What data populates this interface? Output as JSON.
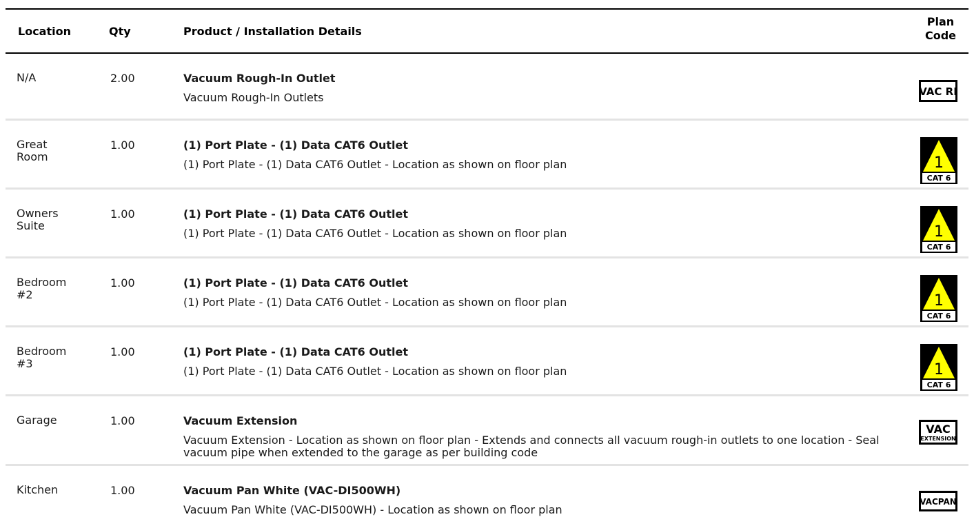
{
  "header": {
    "location": "Location",
    "qty": "Qty",
    "product": "Product / Installation Details",
    "plan_code_line1": "Plan",
    "plan_code_line2": "Code"
  },
  "rows": [
    {
      "location": "N/A",
      "qty": "2.00",
      "title": "Vacuum Rough-In Outlet",
      "description": "Vacuum Rough-In Outlets",
      "plan_code": "VAC RI",
      "icon": "vac-ri-icon"
    },
    {
      "location": "Great Room",
      "qty": "1.00",
      "title": "(1) Port Plate - (1) Data CAT6 Outlet",
      "description": "(1) Port Plate - (1) Data CAT6 Outlet - Location as shown on floor plan",
      "plan_code": "CAT 6",
      "plan_num": "1",
      "icon": "cat6-triangle-icon"
    },
    {
      "location": "Owners Suite",
      "qty": "1.00",
      "title": "(1) Port Plate - (1) Data CAT6 Outlet",
      "description": "(1) Port Plate - (1) Data CAT6 Outlet - Location as shown on floor plan",
      "plan_code": "CAT 6",
      "plan_num": "1",
      "icon": "cat6-triangle-icon"
    },
    {
      "location": "Bedroom #2",
      "qty": "1.00",
      "title": "(1) Port Plate - (1) Data CAT6 Outlet",
      "description": "(1) Port Plate - (1) Data CAT6 Outlet - Location as shown on floor plan",
      "plan_code": "CAT 6",
      "plan_num": "1",
      "icon": "cat6-triangle-icon"
    },
    {
      "location": "Bedroom #3",
      "qty": "1.00",
      "title": "(1) Port Plate - (1) Data CAT6 Outlet",
      "description": "(1) Port Plate - (1) Data CAT6 Outlet - Location as shown on floor plan",
      "plan_code": "CAT 6",
      "plan_num": "1",
      "icon": "cat6-triangle-icon"
    },
    {
      "location": "Garage",
      "qty": "1.00",
      "title": "Vacuum Extension",
      "description": "Vacuum Extension - Location as shown on floor plan - Extends and connects all vacuum rough-in outlets to one location - Seal vacuum pipe when extended to the garage as per building code",
      "plan_code": "VAC",
      "plan_code_sub": "EXTENSION",
      "icon": "vac-extension-icon"
    },
    {
      "location": "Kitchen",
      "qty": "1.00",
      "title": "Vacuum Pan White (VAC-DI500WH)",
      "description": "Vacuum Pan White (VAC-DI500WH) - Location as shown on floor plan",
      "plan_code": "VACPAN",
      "icon": "vacpan-icon"
    }
  ],
  "colors": {
    "triangle_fill": "#ffff00",
    "icon_bg": "#000000"
  }
}
